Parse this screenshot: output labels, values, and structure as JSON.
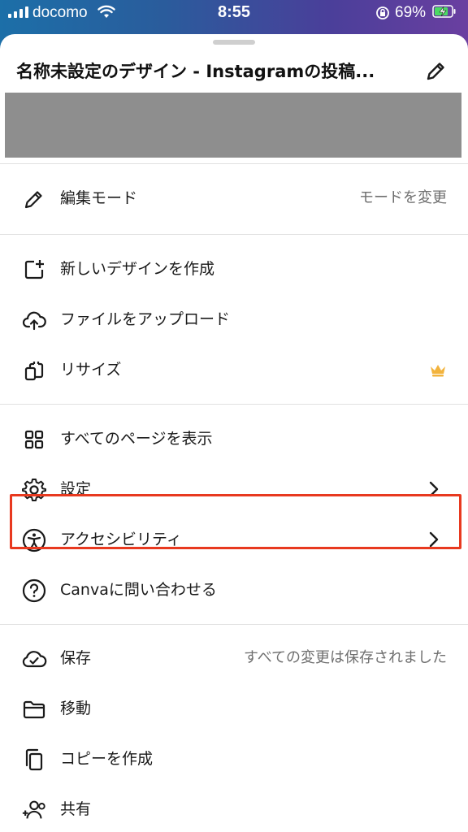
{
  "status_bar": {
    "carrier": "docomo",
    "time": "8:55",
    "battery_percent": "69%"
  },
  "sheet": {
    "title": "名称未設定のデザイン - Instagramの投稿...",
    "sections": [
      {
        "items": [
          {
            "label": "編集モード",
            "icon": "pencil-icon",
            "right_text": "モードを変更"
          }
        ]
      },
      {
        "items": [
          {
            "label": "新しいデザインを作成",
            "icon": "new-design-icon"
          },
          {
            "label": "ファイルをアップロード",
            "icon": "cloud-upload-icon"
          },
          {
            "label": "リサイズ",
            "icon": "resize-icon",
            "badge": "crown-icon"
          }
        ]
      },
      {
        "items": [
          {
            "label": "すべてのページを表示",
            "icon": "grid-icon"
          },
          {
            "label": "設定",
            "icon": "gear-icon",
            "chevron": true,
            "highlighted": true
          },
          {
            "label": "アクセシビリティ",
            "icon": "accessibility-icon",
            "chevron": true
          },
          {
            "label": "Canvaに問い合わせる",
            "icon": "help-icon"
          }
        ]
      },
      {
        "items": [
          {
            "label": "保存",
            "icon": "cloud-check-icon",
            "right_text": "すべての変更は保存されました"
          },
          {
            "label": "移動",
            "icon": "folder-icon"
          },
          {
            "label": "コピーを作成",
            "icon": "copy-icon"
          },
          {
            "label": "共有",
            "icon": "share-users-icon"
          }
        ]
      }
    ]
  },
  "colors": {
    "highlight": "#e8391f",
    "crown": "#f2b33d",
    "thumbnail": "#8e8e8e"
  }
}
